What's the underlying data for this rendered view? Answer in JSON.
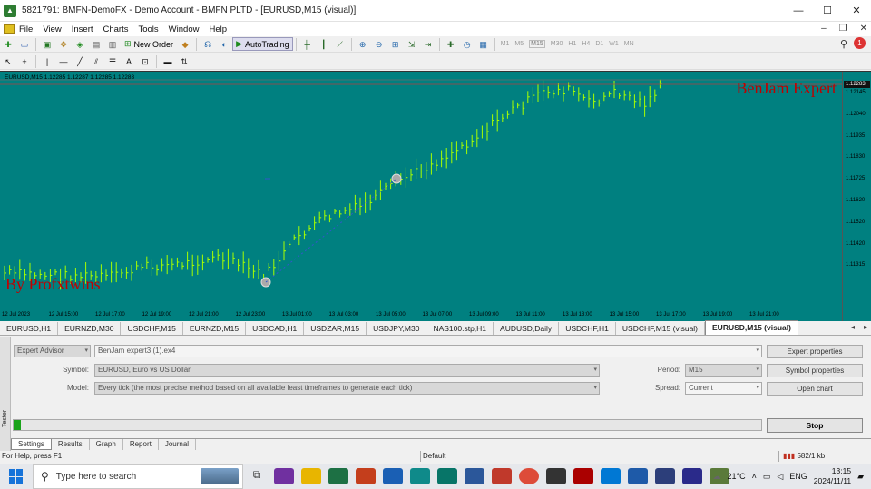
{
  "window": {
    "title": "5821791: BMFN-DemoFX - Demo Account - BMFN PLTD - [EURUSD,M15 (visual)]",
    "min": "—",
    "max": "☐",
    "close": "✕"
  },
  "menu": {
    "items": [
      "File",
      "View",
      "Insert",
      "Charts",
      "Tools",
      "Window",
      "Help"
    ],
    "right_min": "–",
    "right_restore": "❐",
    "right_close": "✕"
  },
  "toolbar": {
    "new_order": "New Order",
    "auto_trading": "AutoTrading",
    "timeframes": [
      "M1",
      "M5",
      "M15",
      "M30",
      "H1",
      "H4",
      "D1",
      "W1",
      "MN"
    ],
    "selected_timeframe": "M15",
    "notification_count": "1"
  },
  "chart": {
    "symbol_info": "EURUSD,M15  1.12285 1.12287 1.12285 1.12283",
    "watermark_top": "BenJam Expert",
    "watermark_bottom": "By Profxtwins",
    "current_price": "1.12283",
    "price_labels": [
      "1.12145",
      "1.12040",
      "1.11935",
      "1.11830",
      "1.11725",
      "1.11620",
      "1.11520",
      "1.11420",
      "1.11315"
    ],
    "time_labels": [
      "12 Jul 2023",
      "12 Jul 15:00",
      "12 Jul 17:00",
      "12 Jul 19:00",
      "12 Jul 21:00",
      "12 Jul 23:00",
      "13 Jul 01:00",
      "13 Jul 03:00",
      "13 Jul 05:00",
      "13 Jul 07:00",
      "13 Jul 09:00",
      "13 Jul 11:00",
      "13 Jul 13:00",
      "13 Jul 15:00",
      "13 Jul 17:00",
      "13 Jul 19:00",
      "13 Jul 21:00"
    ],
    "colors": {
      "background": "#008080",
      "bars": "#a8ff00",
      "watermark": "#c00000"
    }
  },
  "chart_tabs": {
    "tabs": [
      "EURUSD,H1",
      "EURNZD,M30",
      "USDCHF,M15",
      "EURNZD,M15",
      "USDCAD,H1",
      "USDZAR,M15",
      "USDJPY,M30",
      "NAS100.stp,H1",
      "AUDUSD,Daily",
      "USDCHF,H1",
      "USDCHF,M15 (visual)",
      "EURUSD,M15 (visual)"
    ],
    "active": "EURUSD,M15 (visual)"
  },
  "tester": {
    "side_label": "Tester",
    "type": "Expert Advisor",
    "expert": "BenJam expert3 (1).ex4",
    "symbol_label": "Symbol:",
    "symbol": "EURUSD, Euro vs US Dollar",
    "model_label": "Model:",
    "model": "Every tick (the most precise method based on all available least timeframes to generate each tick)",
    "period_label": "Period:",
    "period": "M15",
    "spread_label": "Spread:",
    "spread": "Current",
    "expert_properties": "Expert properties",
    "symbol_properties": "Symbol properties",
    "open_chart": "Open chart",
    "stop": "Stop",
    "progress": 0.01,
    "tabs": [
      "Settings",
      "Results",
      "Graph",
      "Report",
      "Journal"
    ],
    "active_tab": "Settings"
  },
  "statusbar": {
    "help": "For Help, press F1",
    "profile": "Default",
    "traffic": "582/1 kb"
  },
  "taskbar": {
    "search_placeholder": "Type here to search",
    "weather": "21°C",
    "language": "ENG",
    "time": "13:15",
    "date": "2024/11/11"
  }
}
